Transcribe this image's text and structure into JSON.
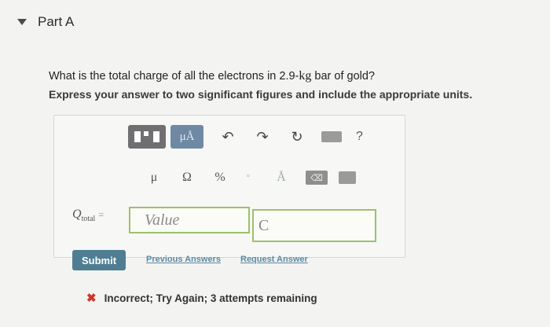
{
  "part": {
    "title": "Part A"
  },
  "question": {
    "text_before": "What is the total charge of all the electrons in 2.9-",
    "unit": "kg",
    "text_after": " bar of gold?",
    "instructions": "Express your answer to two significant figures and include the appropriate units."
  },
  "toolbar": {
    "units_label": "μÅ",
    "help_label": "?",
    "symbols": [
      "μ",
      "Ω",
      "%",
      "°",
      "Å"
    ]
  },
  "answer": {
    "label_main": "Q",
    "label_sub": "total",
    "label_eq": "=",
    "value_placeholder": "Value",
    "unit_value": "C"
  },
  "actions": {
    "submit_label": "Submit",
    "previous_answers_label": "Previous Answers",
    "request_answer_label": "Request Answer"
  },
  "feedback": {
    "icon": "x-icon",
    "text": "Incorrect; Try Again; 3 attempts remaining"
  },
  "colors": {
    "submit": "#4f7e93",
    "link": "#5b8aa6",
    "input_border": "#9bc26a",
    "error": "#d0362a"
  }
}
